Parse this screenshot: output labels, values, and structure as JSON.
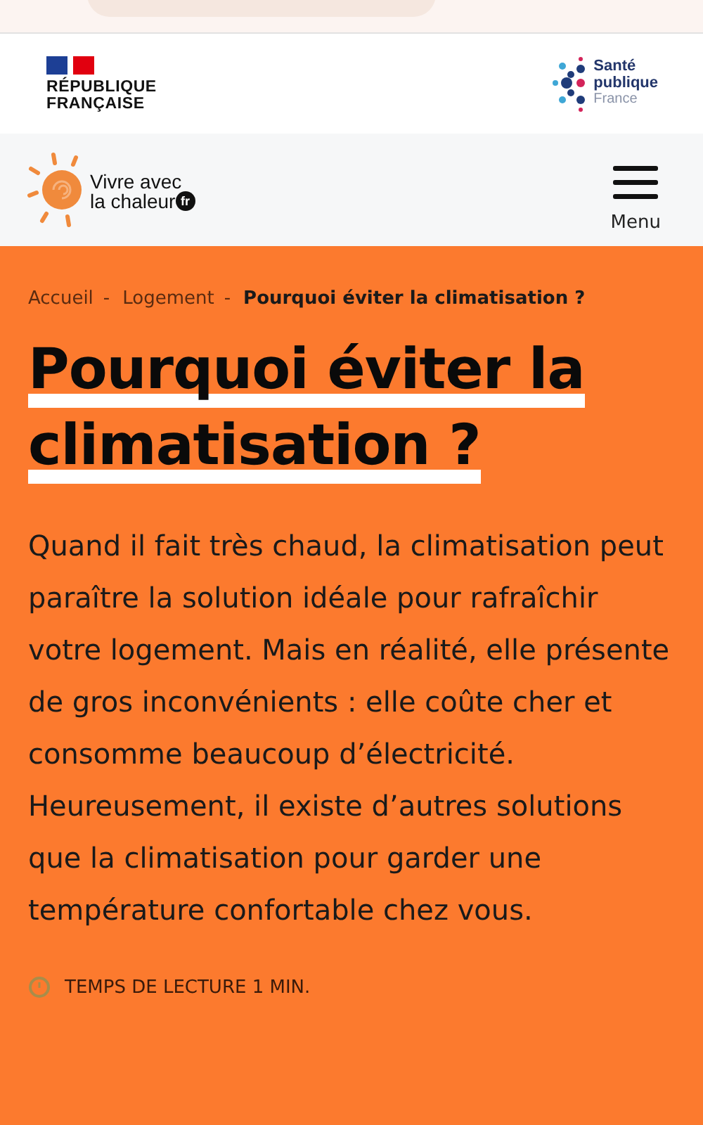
{
  "gov_logo": {
    "lines": [
      "RÉPUBLIQUE",
      "FRANÇAISE"
    ]
  },
  "partner_logo": {
    "lines": [
      "Santé",
      "publique",
      "France"
    ]
  },
  "site_logo": {
    "lines": [
      "Vivre avec",
      "la chaleur"
    ],
    "badge": "fr"
  },
  "menu_button": {
    "label": "Menu"
  },
  "breadcrumb": [
    {
      "label": "Accueil",
      "current": false
    },
    {
      "label": "Logement",
      "current": false
    },
    {
      "label": "Pourquoi éviter la climatisation ?",
      "current": true
    }
  ],
  "breadcrumb_separator": "-",
  "title": "Pourquoi éviter la climatisation ?",
  "intro": "Quand il fait très chaud, la climatisation peut paraître la solution idéale pour rafraîchir votre logement. Mais en réalité, elle présente de gros inconvénients : elle coûte cher et consomme beaucoup d’électricité. Heureusement, il existe d’autres solutions que la climatisation pour garder une température confortable chez vous.",
  "reading_time": "TEMPS DE LECTURE 1 MIN."
}
